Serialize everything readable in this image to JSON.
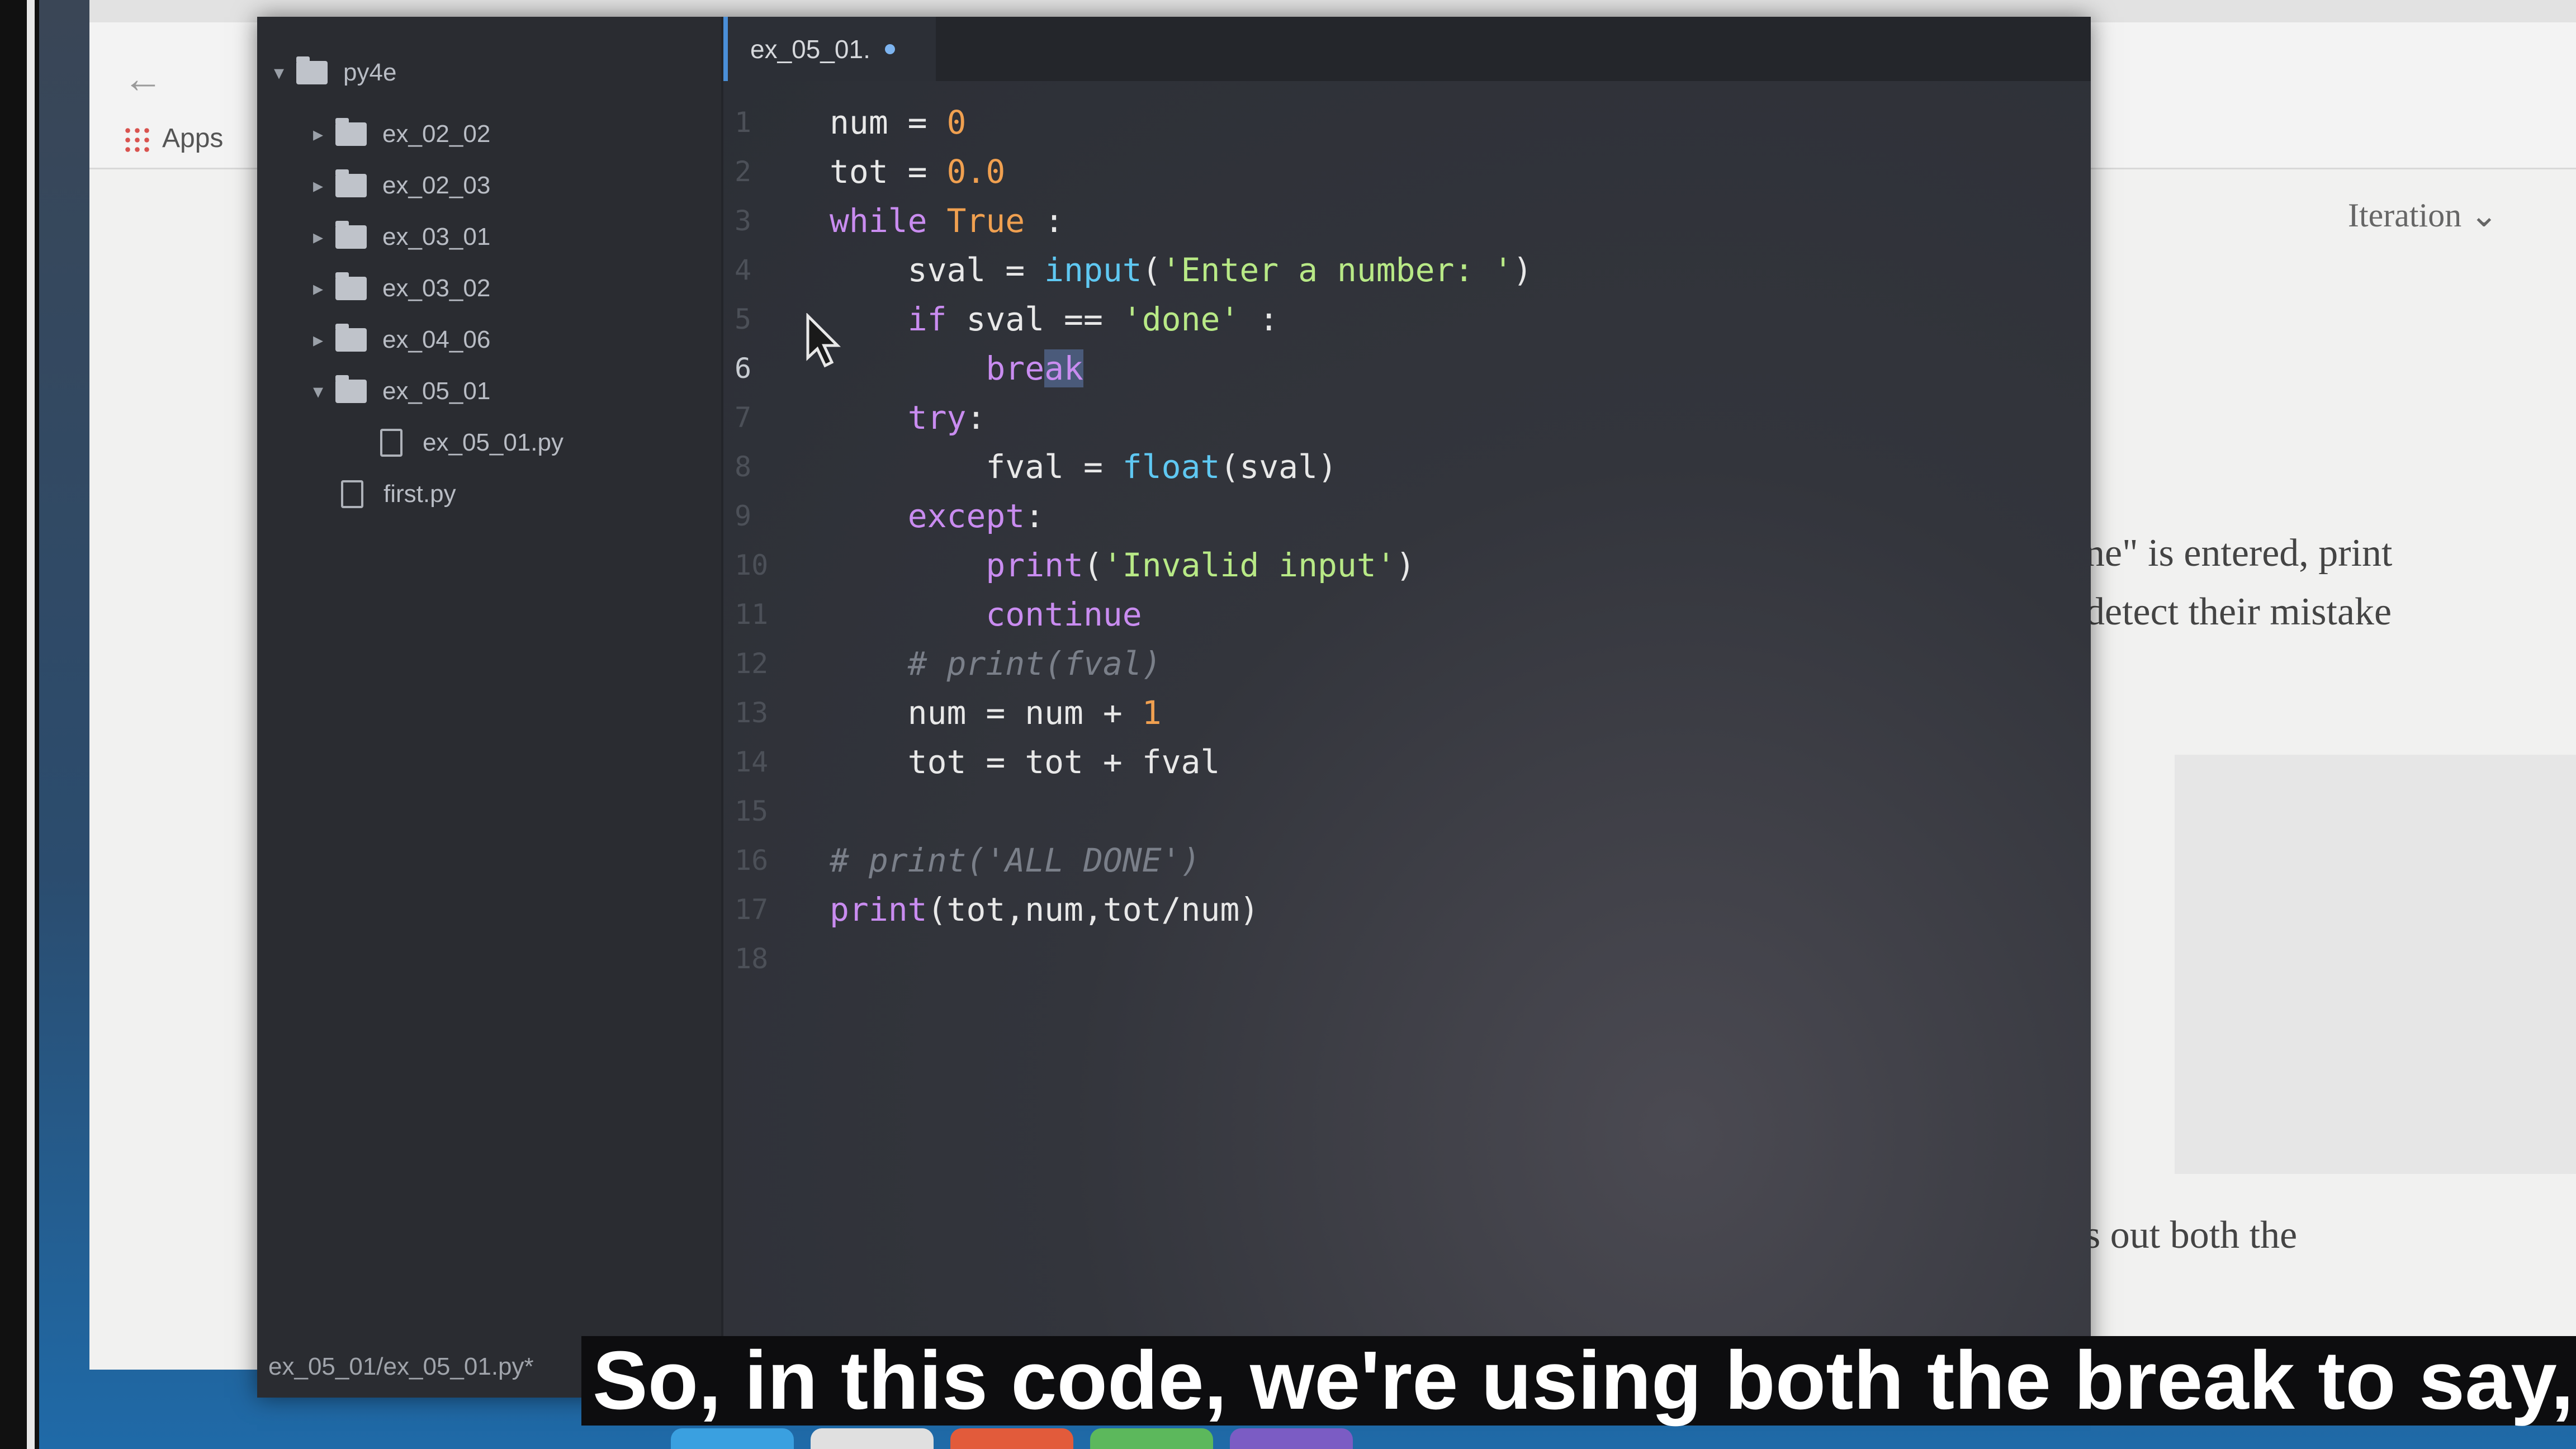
{
  "browser": {
    "apps_label": "Apps",
    "iteration_label": "Iteration",
    "page_text": [
      "ne\" is entered, print",
      "detect their mistake",
      "s out both the"
    ]
  },
  "sidebar": {
    "root": "py4e",
    "items": [
      {
        "label": "ex_02_02",
        "type": "folder",
        "expanded": false
      },
      {
        "label": "ex_02_03",
        "type": "folder",
        "expanded": false
      },
      {
        "label": "ex_03_01",
        "type": "folder",
        "expanded": false
      },
      {
        "label": "ex_03_02",
        "type": "folder",
        "expanded": false
      },
      {
        "label": "ex_04_06",
        "type": "folder",
        "expanded": false
      },
      {
        "label": "ex_05_01",
        "type": "folder",
        "expanded": true
      },
      {
        "label": "ex_05_01.py",
        "type": "file"
      },
      {
        "label": "first.py",
        "type": "file"
      }
    ],
    "status_path": "ex_05_01/ex_05_01.py*"
  },
  "editor": {
    "tab_label": "ex_05_01.",
    "tab_modified": true,
    "active_line": 6,
    "lines": [
      {
        "n": "1",
        "text": "num = 0"
      },
      {
        "n": "2",
        "text": "tot = 0.0"
      },
      {
        "n": "3",
        "text": "while True :"
      },
      {
        "n": "4",
        "text": "    sval = input('Enter a number: ')"
      },
      {
        "n": "5",
        "text": "    if sval == 'done' :"
      },
      {
        "n": "6",
        "text": "        break"
      },
      {
        "n": "7",
        "text": "    try:"
      },
      {
        "n": "8",
        "text": "        fval = float(sval)"
      },
      {
        "n": "9",
        "text": "    except:"
      },
      {
        "n": "10",
        "text": "        print('Invalid input')"
      },
      {
        "n": "11",
        "text": "        continue"
      },
      {
        "n": "12",
        "text": "    # print(fval)"
      },
      {
        "n": "13",
        "text": "    num = num + 1"
      },
      {
        "n": "14",
        "text": "    tot = tot + fval"
      },
      {
        "n": "15",
        "text": ""
      },
      {
        "n": "16",
        "text": "# print('ALL DONE')"
      },
      {
        "n": "17",
        "text": "print(tot,num,tot/num)"
      },
      {
        "n": "18",
        "text": ""
      }
    ]
  },
  "subtitle": "So, in this code, we're using both the break to say,",
  "colors": {
    "keyword": "#c98cf0",
    "function": "#5fc8f2",
    "string": "#b8e986",
    "number": "#f0a050",
    "comment": "#7a7f89"
  }
}
